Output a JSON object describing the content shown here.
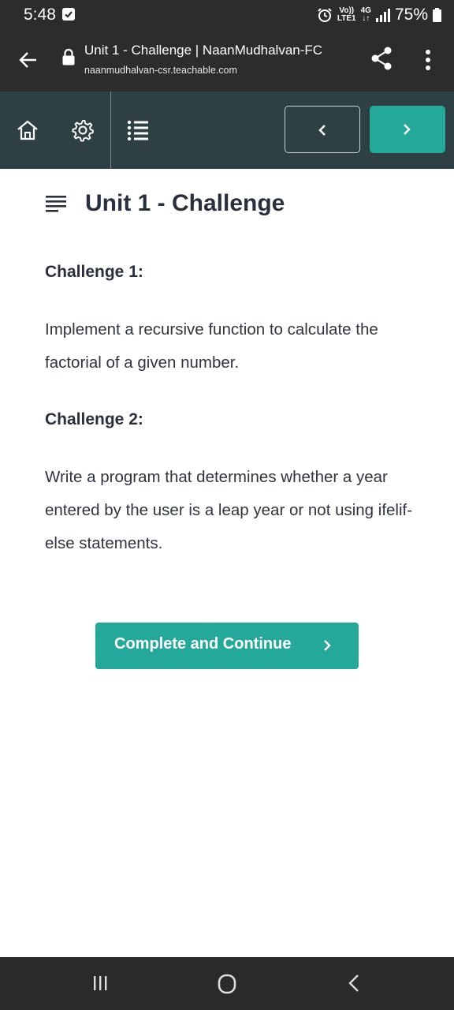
{
  "status_bar": {
    "time": "5:48",
    "volte_top": "Vo))",
    "volte_bottom": "LTE1",
    "network": "4G",
    "battery": "75%",
    "icons": [
      "check-icon",
      "alarm-icon",
      "signal-icon",
      "battery-icon"
    ]
  },
  "browser": {
    "page_title": "Unit 1 - Challenge | NaanMudhalvan-FC",
    "host": "naanmudhalvan-csr.teachable.com",
    "icons": [
      "back-arrow-icon",
      "lock-icon",
      "share-icon",
      "more-vert-icon"
    ]
  },
  "course_nav": {
    "icons": [
      "home-icon",
      "gear-icon",
      "list-icon",
      "chevron-left-icon",
      "chevron-right-icon"
    ],
    "accent_color": "#24a89a",
    "background_color": "#2e4044"
  },
  "lesson": {
    "title": "Unit 1 - Challenge",
    "sections": [
      {
        "heading": "Challenge 1:",
        "body": "Implement a recursive function to calculate the factorial of a given number."
      },
      {
        "heading": "Challenge 2:",
        "body": "Write a program that determines whether a year entered by the user is a leap year or not using ifelif-else statements."
      }
    ],
    "complete_button": "Complete and Continue"
  },
  "system_nav": {
    "icons": [
      "recents-icon",
      "home-circle-icon",
      "back-chevron-icon"
    ]
  }
}
